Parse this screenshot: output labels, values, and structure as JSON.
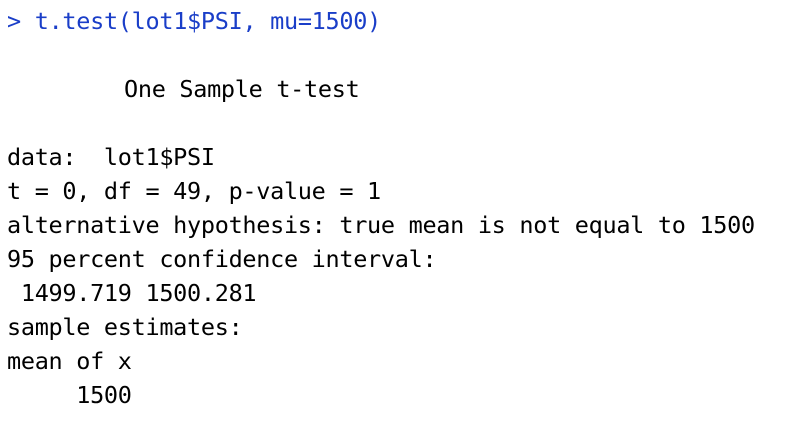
{
  "console": {
    "prompt": ">",
    "command": "t.test(lot1$PSI, mu=1500)",
    "title": "One Sample t-test",
    "data_line": "data:  lot1$PSI",
    "stats_line": "t = 0, df = 49, p-value = 1",
    "alternative_line": "alternative hypothesis: true mean is not equal to 1500",
    "ci_header": "95 percent confidence interval:",
    "ci_values": " 1499.719 1500.281",
    "estimates_header": "sample estimates:",
    "estimate_label": "mean of x",
    "estimate_value": "     1500"
  },
  "colors": {
    "command": "#1a3ec8",
    "output": "#000000",
    "background": "#ffffff"
  }
}
